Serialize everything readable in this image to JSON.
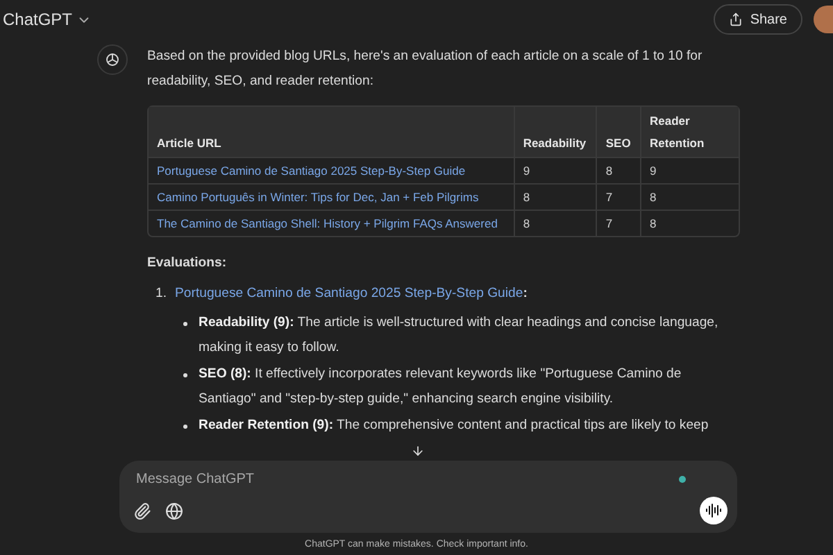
{
  "header": {
    "title": "ChatGPT",
    "share_label": "Share"
  },
  "message": {
    "intro": "Based on the provided blog URLs, here's an evaluation of each article on a scale of 1 to 10 for readability, SEO, and reader retention:",
    "table": {
      "columns": [
        "Article URL",
        "Readability",
        "SEO",
        "Reader Retention"
      ],
      "rows": [
        [
          "Portuguese Camino de Santiago 2025 Step-By-Step Guide",
          "9",
          "8",
          "9"
        ],
        [
          "Camino Português in Winter: Tips for Dec, Jan + Feb Pilgrims",
          "8",
          "7",
          "8"
        ],
        [
          "The Camino de Santiago Shell: History + Pilgrim FAQs Answered",
          "8",
          "7",
          "8"
        ]
      ]
    },
    "heading": "Evaluations:",
    "evaluations": [
      {
        "number": "1.",
        "link": "Portuguese Camino de Santiago 2025 Step-By-Step Guide",
        "suffix": ":",
        "points": [
          "**Readability (9):** The article is well-structured with clear headings and concise language, making it easy to follow.",
          "**SEO (8):** It effectively incorporates relevant keywords like \"Portuguese Camino de Santiago\" and \"step-by-step guide,\" enhancing search engine visibility.",
          "**Reader Retention (9):** The comprehensive content and practical tips are likely to keep"
        ]
      }
    ]
  },
  "composer": {
    "placeholder": "Message ChatGPT"
  },
  "disclaimer": "ChatGPT can make mistakes. Check important info."
}
